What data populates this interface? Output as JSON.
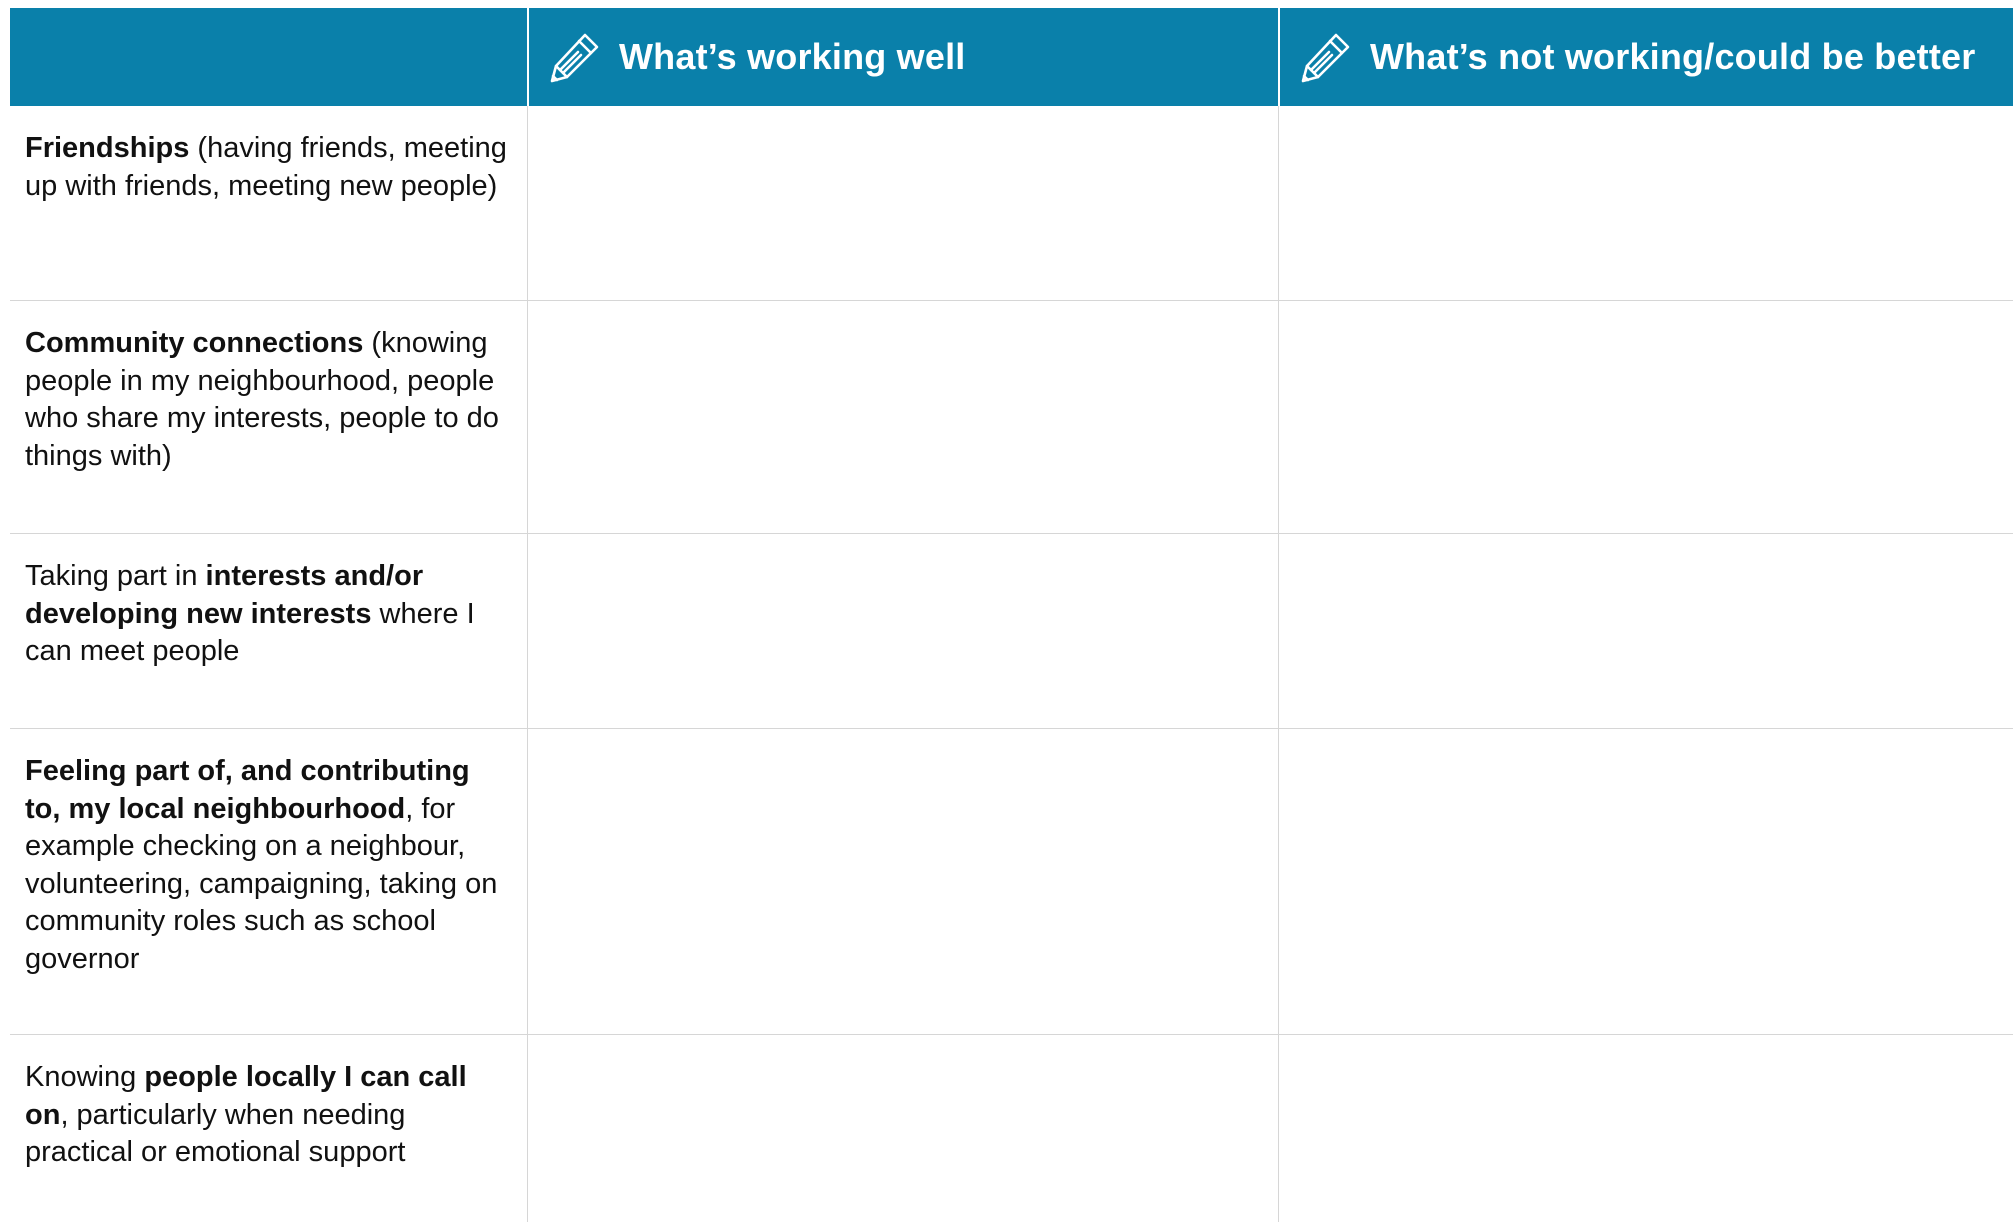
{
  "header": {
    "columns": [
      {
        "label": "",
        "icon": "pencil-icon"
      },
      {
        "label": "What’s working well",
        "icon": "pencil-icon"
      },
      {
        "label": "What’s not working/could be better",
        "icon": "pencil-icon"
      }
    ]
  },
  "colors": {
    "header_bg": "#0a80aa",
    "header_text": "#ffffff",
    "grid_line": "#d6d6d6"
  },
  "rows": [
    {
      "segments": [
        {
          "text": "Friendships",
          "bold": true
        },
        {
          "text": " (having friends, meeting up with friends, meeting new people)",
          "bold": false
        }
      ],
      "working_well": "",
      "not_working": ""
    },
    {
      "segments": [
        {
          "text": "Community connections",
          "bold": true
        },
        {
          "text": " (knowing people in my neighbourhood, people who share my interests, people to do things with)",
          "bold": false
        }
      ],
      "working_well": "",
      "not_working": ""
    },
    {
      "segments": [
        {
          "text": "Taking part in ",
          "bold": false
        },
        {
          "text": "interests and/or developing new interests",
          "bold": true
        },
        {
          "text": " where I can meet people",
          "bold": false
        }
      ],
      "working_well": "",
      "not_working": ""
    },
    {
      "segments": [
        {
          "text": "Feeling part of, and contributing to, my local neighbourhood",
          "bold": true
        },
        {
          "text": ", for example checking on a neighbour, volunteering, campaigning, taking on community roles such as school governor",
          "bold": false
        }
      ],
      "working_well": "",
      "not_working": ""
    },
    {
      "segments": [
        {
          "text": "Knowing ",
          "bold": false
        },
        {
          "text": "people locally I can call on",
          "bold": true
        },
        {
          "text": ", particularly when needing practical or emotional support",
          "bold": false
        }
      ],
      "working_well": "",
      "not_working": ""
    }
  ]
}
